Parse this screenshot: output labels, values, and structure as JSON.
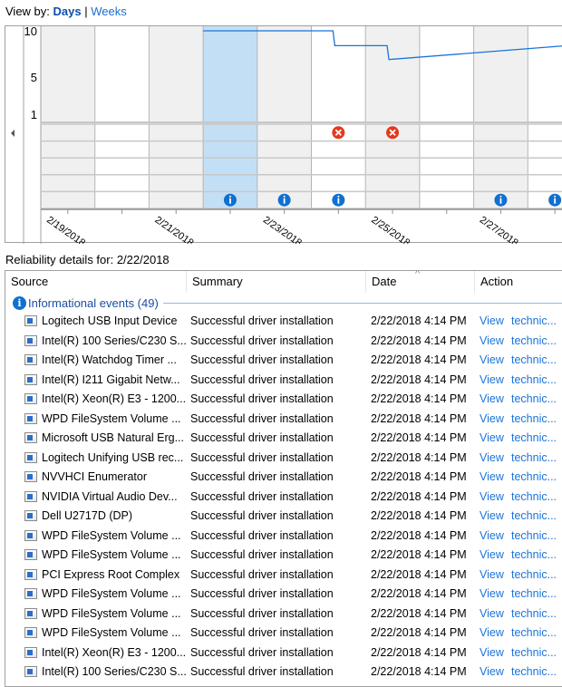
{
  "view_by": {
    "label": "View by:",
    "days": "Days",
    "separator": "|",
    "weeks": "Weeks",
    "selected": "Days"
  },
  "chart_data": {
    "type": "line",
    "y_ticks": [
      "10",
      "5",
      "1"
    ],
    "ylim": [
      1,
      10
    ],
    "days": [
      "2/19/2018",
      "2/20/2018",
      "2/21/2018",
      "2/22/2018",
      "2/23/2018",
      "2/24/2018",
      "2/25/2018",
      "2/26/2018",
      "2/27/2018",
      "2/28/2018"
    ],
    "x_tick_labels": [
      "2/19/2018",
      "2/21/2018",
      "2/23/2018",
      "2/25/2018",
      "2/27/2018"
    ],
    "selected_day": "2/22/2018",
    "stability_index": [
      {
        "date": "2/22/2018",
        "value": 10
      },
      {
        "date": "2/23/2018",
        "value": 10
      },
      {
        "date": "2/24/2018",
        "value": 8.4
      },
      {
        "date": "2/25/2018",
        "value": 6.9
      },
      {
        "date": "2/28/2018",
        "value": 8.3
      }
    ],
    "critical_events": [
      "2/24/2018",
      "2/25/2018"
    ],
    "informational_events": [
      "2/22/2018",
      "2/23/2018",
      "2/24/2018",
      "2/27/2018",
      "2/28/2018"
    ],
    "colors": {
      "line": "#1a73d9",
      "selected": "#c3dff5",
      "shaded": "#f0f0f0",
      "critical": "#e03a1e",
      "info": "#1170cf"
    }
  },
  "nav": {
    "scroll_left_icon": "triangle-left"
  },
  "details": {
    "title": "Reliability details for: 2/22/2018"
  },
  "table": {
    "columns": [
      "Source",
      "Summary",
      "Date",
      "Action"
    ],
    "sort_indicator": "^",
    "group": {
      "label": "Informational events (49)",
      "icon": "info-icon"
    },
    "rows": [
      {
        "source": "Logitech USB Input Device",
        "summary": "Successful driver installation",
        "date": "2/22/2018 4:14 PM",
        "view": "View",
        "tech": "technic..."
      },
      {
        "source": "Intel(R) 100 Series/C230 S...",
        "summary": "Successful driver installation",
        "date": "2/22/2018 4:14 PM",
        "view": "View",
        "tech": "technic..."
      },
      {
        "source": "Intel(R) Watchdog Timer ...",
        "summary": "Successful driver installation",
        "date": "2/22/2018 4:14 PM",
        "view": "View",
        "tech": "technic..."
      },
      {
        "source": "Intel(R) I211 Gigabit Netw...",
        "summary": "Successful driver installation",
        "date": "2/22/2018 4:14 PM",
        "view": "View",
        "tech": "technic..."
      },
      {
        "source": "Intel(R) Xeon(R) E3 - 1200...",
        "summary": "Successful driver installation",
        "date": "2/22/2018 4:14 PM",
        "view": "View",
        "tech": "technic..."
      },
      {
        "source": "WPD FileSystem Volume ...",
        "summary": "Successful driver installation",
        "date": "2/22/2018 4:14 PM",
        "view": "View",
        "tech": "technic..."
      },
      {
        "source": "Microsoft USB Natural Erg...",
        "summary": "Successful driver installation",
        "date": "2/22/2018 4:14 PM",
        "view": "View",
        "tech": "technic..."
      },
      {
        "source": "Logitech Unifying USB rec...",
        "summary": "Successful driver installation",
        "date": "2/22/2018 4:14 PM",
        "view": "View",
        "tech": "technic..."
      },
      {
        "source": "NVVHCI Enumerator",
        "summary": "Successful driver installation",
        "date": "2/22/2018 4:14 PM",
        "view": "View",
        "tech": "technic..."
      },
      {
        "source": "NVIDIA Virtual Audio Dev...",
        "summary": "Successful driver installation",
        "date": "2/22/2018 4:14 PM",
        "view": "View",
        "tech": "technic..."
      },
      {
        "source": "Dell U2717D (DP)",
        "summary": "Successful driver installation",
        "date": "2/22/2018 4:14 PM",
        "view": "View",
        "tech": "technic..."
      },
      {
        "source": "WPD FileSystem Volume ...",
        "summary": "Successful driver installation",
        "date": "2/22/2018 4:14 PM",
        "view": "View",
        "tech": "technic..."
      },
      {
        "source": "WPD FileSystem Volume ...",
        "summary": "Successful driver installation",
        "date": "2/22/2018 4:14 PM",
        "view": "View",
        "tech": "technic..."
      },
      {
        "source": "PCI Express Root Complex",
        "summary": "Successful driver installation",
        "date": "2/22/2018 4:14 PM",
        "view": "View",
        "tech": "technic..."
      },
      {
        "source": "WPD FileSystem Volume ...",
        "summary": "Successful driver installation",
        "date": "2/22/2018 4:14 PM",
        "view": "View",
        "tech": "technic..."
      },
      {
        "source": "WPD FileSystem Volume ...",
        "summary": "Successful driver installation",
        "date": "2/22/2018 4:14 PM",
        "view": "View",
        "tech": "technic..."
      },
      {
        "source": "WPD FileSystem Volume ...",
        "summary": "Successful driver installation",
        "date": "2/22/2018 4:14 PM",
        "view": "View",
        "tech": "technic..."
      },
      {
        "source": "Intel(R) Xeon(R) E3 - 1200...",
        "summary": "Successful driver installation",
        "date": "2/22/2018 4:14 PM",
        "view": "View",
        "tech": "technic..."
      },
      {
        "source": "Intel(R) 100 Series/C230 S...",
        "summary": "Successful driver installation",
        "date": "2/22/2018 4:14 PM",
        "view": "View",
        "tech": "technic..."
      }
    ]
  }
}
